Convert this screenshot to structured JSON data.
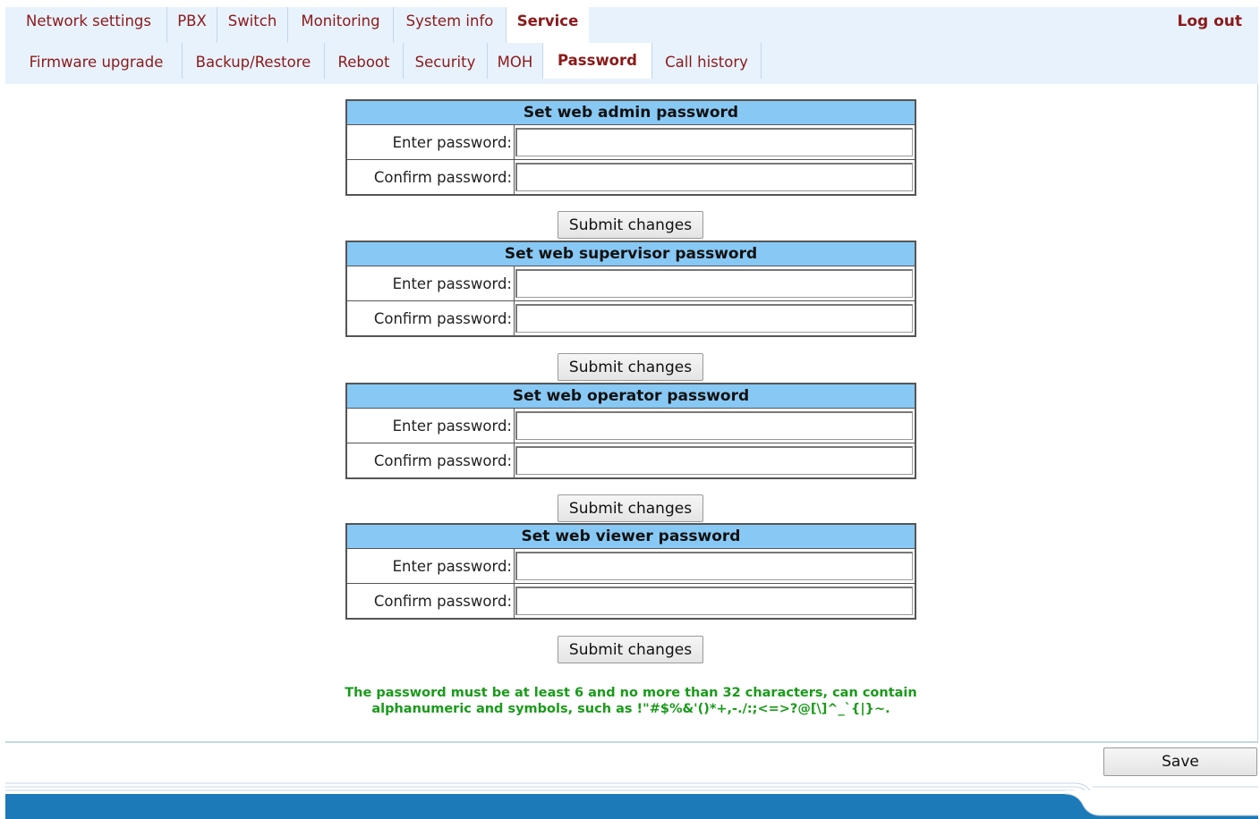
{
  "top_nav": {
    "tabs": [
      {
        "label": "Network settings",
        "active": false
      },
      {
        "label": "PBX",
        "active": false
      },
      {
        "label": "Switch",
        "active": false
      },
      {
        "label": "Monitoring",
        "active": false
      },
      {
        "label": "System info",
        "active": false
      },
      {
        "label": "Service",
        "active": true
      }
    ],
    "logout_label": "Log out"
  },
  "sub_nav": {
    "tabs": [
      {
        "label": "Firmware upgrade",
        "active": false
      },
      {
        "label": "Backup/Restore",
        "active": false
      },
      {
        "label": "Reboot",
        "active": false
      },
      {
        "label": "Security",
        "active": false
      },
      {
        "label": "MOH",
        "active": false
      },
      {
        "label": "Password",
        "active": true
      },
      {
        "label": "Call history",
        "active": false
      }
    ]
  },
  "password_sections": [
    {
      "title": "Set web admin password",
      "enter_label": "Enter password:",
      "confirm_label": "Confirm password:",
      "submit_label": "Submit changes"
    },
    {
      "title": "Set web supervisor password",
      "enter_label": "Enter password:",
      "confirm_label": "Confirm password:",
      "submit_label": "Submit changes"
    },
    {
      "title": "Set web operator password",
      "enter_label": "Enter password:",
      "confirm_label": "Confirm password:",
      "submit_label": "Submit changes"
    },
    {
      "title": "Set web viewer password",
      "enter_label": "Enter password:",
      "confirm_label": "Confirm password:",
      "submit_label": "Submit changes"
    }
  ],
  "note": {
    "line1": "The password must be at least 6 and no more than 32 characters, can contain",
    "line2": "alphanumeric and symbols, such as !\"#$%&'()*+,-./:;<=>?@[\\]^_`{|}~."
  },
  "save_label": "Save",
  "colors": {
    "nav_bg": "#e8f2fd",
    "tab_text": "#8b1a1a",
    "section_header": "#88c8f4",
    "note_text": "#1a9a1a",
    "footer_bar": "#1d7ab8"
  }
}
